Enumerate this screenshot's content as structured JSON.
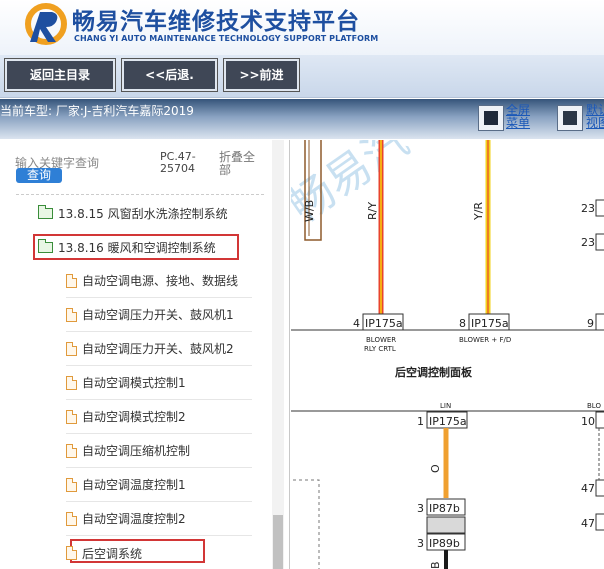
{
  "header": {
    "title": "畅易汽车维修技术支持平台",
    "subtitle": "CHANG YI AUTO MAINTENANCE TECHNOLOGY SUPPORT PLATFORM"
  },
  "toolbar": {
    "home_label": "返回主目录",
    "back_label": "<<后退.",
    "forward_label": ">>前进"
  },
  "modelbar": {
    "model_text": "当前车型:  厂家:J-吉利汽车嘉际2019",
    "fullscreen_line1": "全屏",
    "fullscreen_line2": "菜单",
    "default_line1": "默认",
    "default_line2": "视图"
  },
  "search": {
    "placeholder_label": "输入关键字查询",
    "button_label": "查询",
    "pc_code": "PC.47-25704",
    "collapse_label": "折叠全部"
  },
  "tree": {
    "folders": [
      {
        "label": "13.8.15 风窗刮水洗涤控制系统"
      },
      {
        "label": "13.8.16 暖风和空调控制系统"
      }
    ],
    "children": [
      {
        "label": "自动空调电源、接地、数据线"
      },
      {
        "label": "自动空调压力开关、鼓风机1"
      },
      {
        "label": "自动空调压力开关、鼓风机2"
      },
      {
        "label": "自动空调模式控制1"
      },
      {
        "label": "自动空调模式控制2"
      },
      {
        "label": "自动空调压缩机控制"
      },
      {
        "label": "自动空调温度控制1"
      },
      {
        "label": "自动空调温度控制2"
      },
      {
        "label": "后空调系统"
      }
    ]
  },
  "diagram": {
    "wire_wb": "W/B",
    "wire_ry": "R/Y",
    "wire_yr": "Y/R",
    "wire_o": "O",
    "wire_b": "B",
    "pin_4": "4",
    "pin_8": "8",
    "pin_9": "9",
    "pin_1": "1",
    "pin_3a": "3",
    "pin_3b": "3",
    "pin_10": "10",
    "pin_23a": "23",
    "pin_23b": "23",
    "pin_47a": "47",
    "pin_47b": "47",
    "conn_ip175a_1": "IP175a",
    "conn_ip175a_2": "IP175a",
    "conn_ip175a_4": "IP175a",
    "conn_ip87b": "IP87b",
    "conn_ip89b": "IP89b",
    "cap_blower_rly": "BLOWER",
    "cap_blower_rly2": "RLY CRTL",
    "cap_blower_fd": "BLOWER + F/D",
    "cap_lin": "LIN",
    "cap_blo": "BLO",
    "panel_title": "后空调控制面板",
    "watermark": "畅易汽"
  },
  "colors": {
    "brand_blue": "#1e4fa0",
    "toolbar_button": "#3f4756",
    "highlight_red": "#d23636",
    "wire_red": "#e8452c",
    "wire_yellow": "#f2d21a",
    "wire_orange": "#f0a030"
  }
}
